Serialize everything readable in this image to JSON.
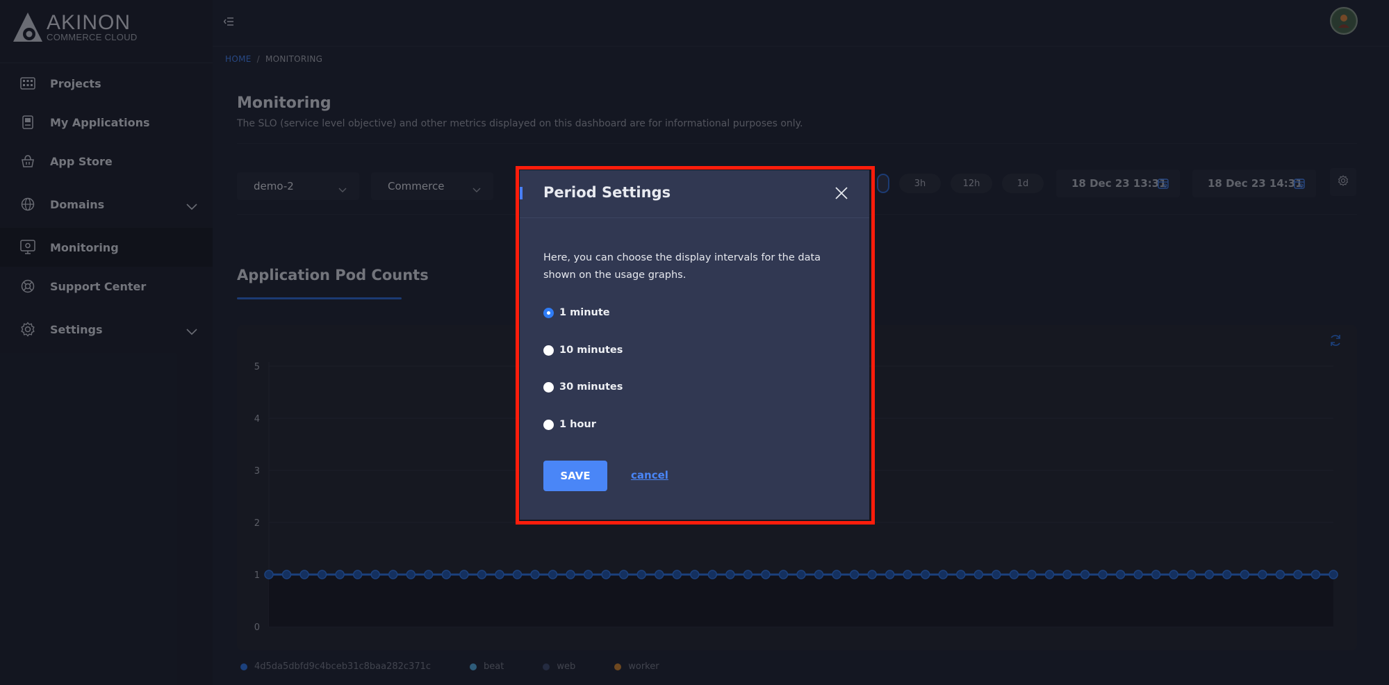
{
  "brand": {
    "name": "AKINON",
    "subtitle": "COMMERCE CLOUD"
  },
  "sidebar": {
    "items": [
      {
        "label": "Projects",
        "icon": "grid-icon"
      },
      {
        "label": "My Applications",
        "icon": "app-icon"
      },
      {
        "label": "App Store",
        "icon": "shopping-basket-icon"
      },
      {
        "label": "Domains",
        "icon": "globe-icon",
        "expandable": true
      },
      {
        "label": "Monitoring",
        "icon": "monitor-icon",
        "active": true
      },
      {
        "label": "Support Center",
        "icon": "lifebuoy-icon"
      },
      {
        "label": "Settings",
        "icon": "gear-icon",
        "expandable": true
      }
    ]
  },
  "breadcrumb": {
    "home": "HOME",
    "separator": "/",
    "current": "MONITORING"
  },
  "page": {
    "title": "Monitoring",
    "description": "The SLO (service level objective) and other metrics displayed on this dashboard are for informational purposes only."
  },
  "filters": {
    "project": "demo-2",
    "application": "Commerce",
    "ranges": [
      "3h",
      "12h",
      "1d"
    ],
    "start_date": "18 Dec 23 13:31",
    "end_date": "18 Dec 23 14:31"
  },
  "section": {
    "title": "Application Pod Counts"
  },
  "chart_data": {
    "type": "line",
    "title": "",
    "xlabel": "",
    "ylabel": "",
    "ylim": [
      0,
      5
    ],
    "yticks": [
      0,
      1,
      2,
      3,
      4,
      5
    ],
    "grid": true,
    "legend_position": "bottom-left",
    "series": [
      {
        "name": "4d5da5dbfd9c4bceb31c8baa282c371c",
        "color": "#2a6dd6",
        "values": [
          1,
          1,
          1,
          1,
          1,
          1,
          1,
          1,
          1,
          1,
          1,
          1,
          1,
          1,
          1,
          1,
          1,
          1,
          1,
          1,
          1,
          1,
          1,
          1,
          1,
          1,
          1,
          1,
          1,
          1,
          1,
          1,
          1,
          1,
          1,
          1,
          1,
          1,
          1,
          1,
          1,
          1,
          1,
          1,
          1,
          1,
          1,
          1,
          1,
          1,
          1,
          1,
          1,
          1,
          1,
          1,
          1,
          1,
          1,
          1,
          1
        ]
      },
      {
        "name": "beat",
        "color": "#4c9fd0",
        "values": []
      },
      {
        "name": "web",
        "color": "#3a4566",
        "values": []
      },
      {
        "name": "worker",
        "color": "#c07a2c",
        "values": []
      }
    ]
  },
  "modal": {
    "title": "Period Settings",
    "description": "Here, you can choose the display intervals for the data shown on the usage graphs.",
    "options": [
      "1 minute",
      "10 minutes",
      "30 minutes",
      "1 hour"
    ],
    "selected": "1 minute",
    "save_label": "SAVE",
    "cancel_label": "cancel"
  },
  "colors": {
    "accent": "#4a86f7",
    "highlight_frame": "#ff1d0b",
    "background": "#1d2130"
  }
}
